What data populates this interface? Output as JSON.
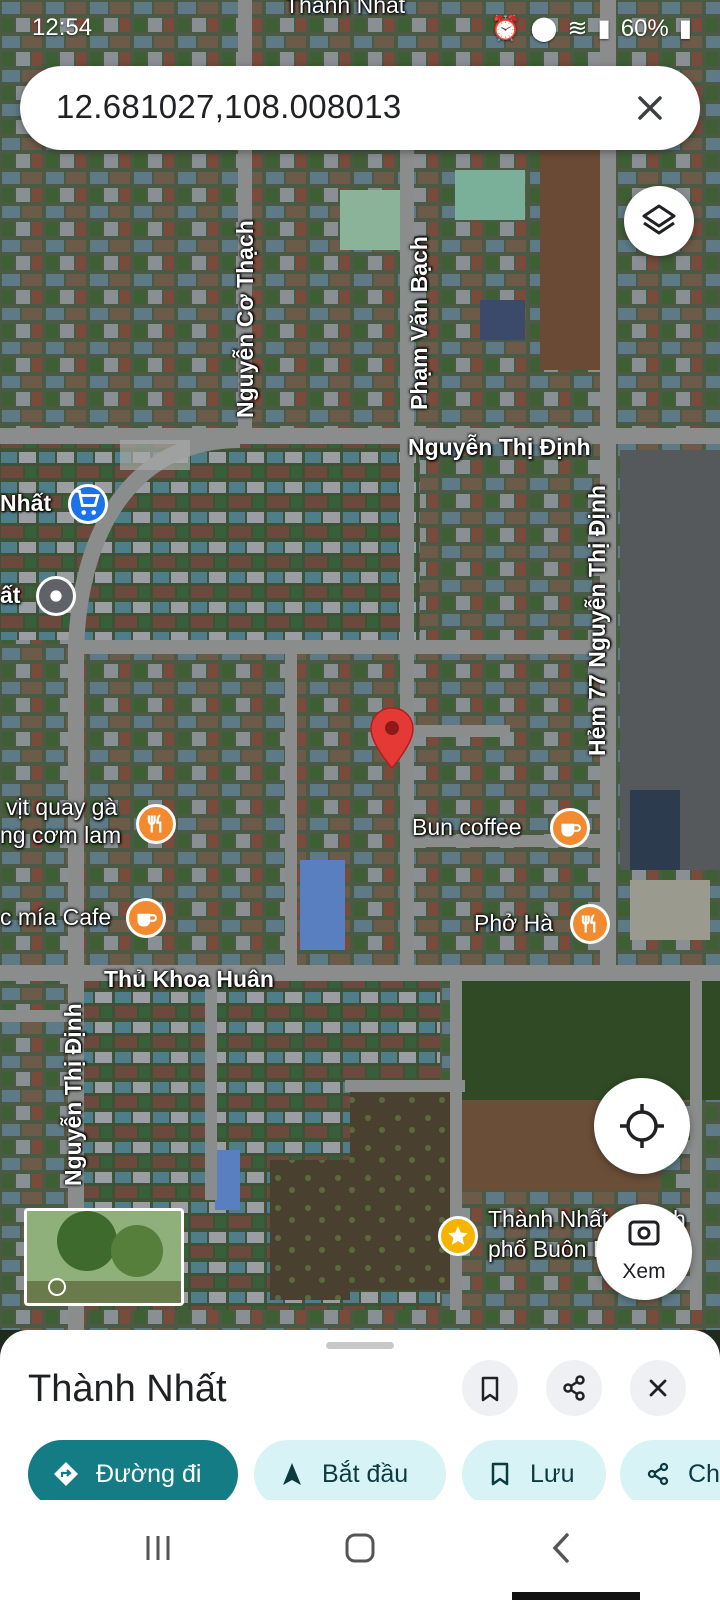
{
  "status_bar": {
    "time": "12:54",
    "battery": "60%"
  },
  "search": {
    "query": "12.681027,108.008013"
  },
  "map": {
    "street_labels": [
      {
        "text": "Nguyễn Cơ Thạch"
      },
      {
        "text": "Phạm Văn Bạch"
      },
      {
        "text": "Nguyễn Thị Định"
      },
      {
        "text": "Hẻm 77 Nguyễn Thị Định"
      },
      {
        "text": "Thủ Khoa Huân"
      },
      {
        "text": "Nguyễn Thị Định"
      },
      {
        "text": "Thành Nhất"
      }
    ],
    "pois": [
      {
        "text": "Nhất",
        "icon": "shopping-cart-icon",
        "color": "#1a73e8"
      },
      {
        "text": "ất",
        "icon": "location-dot-icon",
        "color": "#5f6368"
      },
      {
        "text": "vịt quay gà",
        "text2": "ng cơm lam",
        "icon": "restaurant-icon",
        "color": "#f28b30"
      },
      {
        "text": "c mía Cafe",
        "icon": "coffee-icon",
        "color": "#f28b30"
      },
      {
        "text": "Bun coffee",
        "icon": "coffee-icon",
        "color": "#f28b30"
      },
      {
        "text": "Phở Hà",
        "icon": "restaurant-icon",
        "color": "#f28b30"
      },
      {
        "text": "Thành Nhất, Thành",
        "text2": "phố Buôn Ma Thuột",
        "icon": "star-icon",
        "color": "#f4b400"
      }
    ],
    "pin_color": "#e53935"
  },
  "buttons": {
    "layers": "layers-icon",
    "my_location": "my-location-icon",
    "street_view_label": "Xem"
  },
  "sheet": {
    "title": "Thành Nhất",
    "actions": {
      "directions": "Đường đi",
      "start": "Bắt đầu",
      "save": "Lưu",
      "share": "Ch"
    }
  },
  "colors": {
    "accent": "#137c84",
    "chip": "#d7f3f6"
  }
}
